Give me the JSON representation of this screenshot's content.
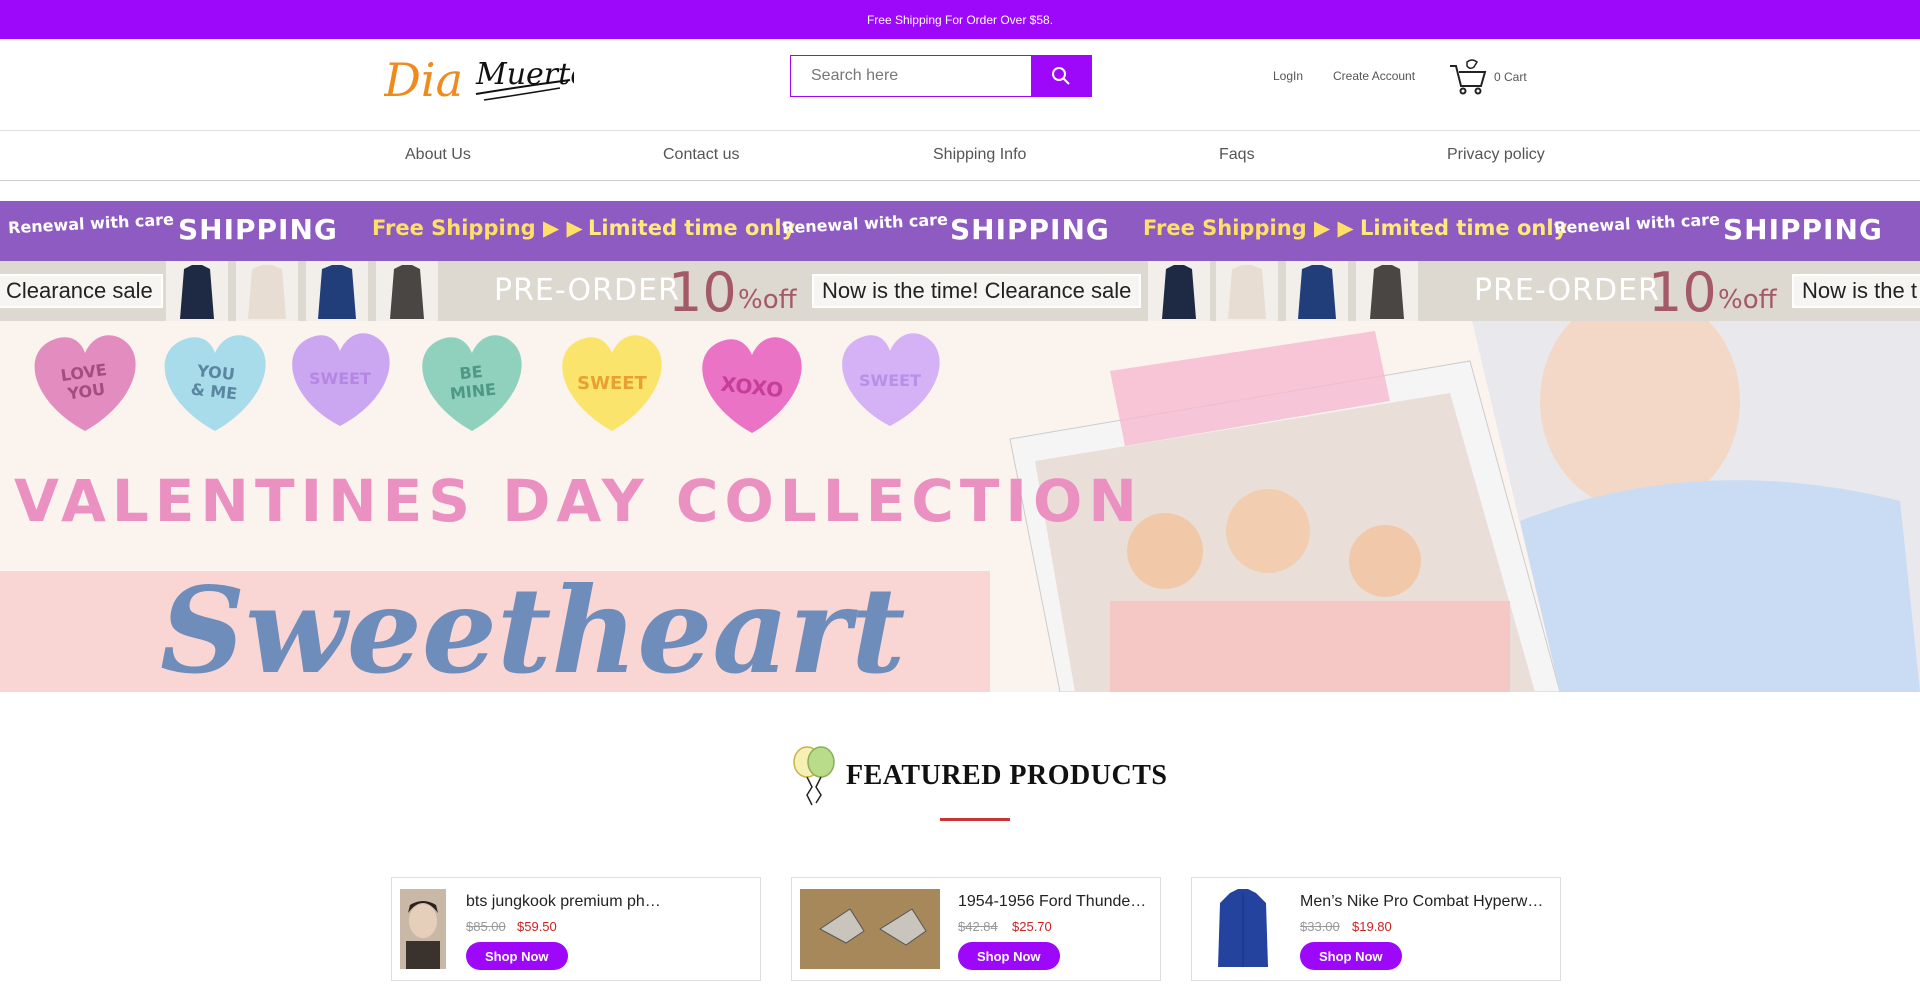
{
  "announcement": "Free Shipping For Order Over $58.",
  "header": {
    "search_placeholder": "Search here",
    "login": "LogIn",
    "create_account": "Create Account",
    "cart": "0 Cart"
  },
  "nav": [
    "About Us",
    "Contact us",
    "Shipping Info",
    "Faqs",
    "Privacy policy"
  ],
  "marquee1": {
    "renewal": "Renewal with care",
    "shipping": "SHIPPING",
    "free_shipping": "Free Shipping ▶ ▶",
    "limited": "Limited time only"
  },
  "marquee2": {
    "clearance": "Clearance sale",
    "preorder": "PRE-ORDER",
    "ten": "10",
    "off": "%off",
    "now": "Now is the time! Clearance sale",
    "now_cut": "Now is the t"
  },
  "hero": {
    "hearts": [
      "LOVE YOU",
      "YOU & ME",
      "SWEET",
      "BE MINE",
      "SWEET",
      "XOXO",
      "SWEET"
    ],
    "collection": "VALENTINES DAY COLLECTION",
    "sweetheart": "Sweetheart"
  },
  "featured_title": "FEATURED PRODUCTS",
  "products": [
    {
      "title": "bts jungkook premium photo",
      "old_price": "$85.00",
      "new_price": "$59.50",
      "cta": "Shop Now"
    },
    {
      "title": "1954-1956 Ford Thunde…",
      "old_price": "$42.84",
      "new_price": "$25.70",
      "cta": "Shop Now"
    },
    {
      "title": "Men’s Nike Pro Combat Hyperw…",
      "old_price": "$33.00",
      "new_price": "$19.80",
      "cta": "Shop Now"
    }
  ],
  "colors": {
    "brand": "#9d08fb",
    "sale_price": "#cc2222",
    "marquee_purple": "#8d5bc1"
  }
}
